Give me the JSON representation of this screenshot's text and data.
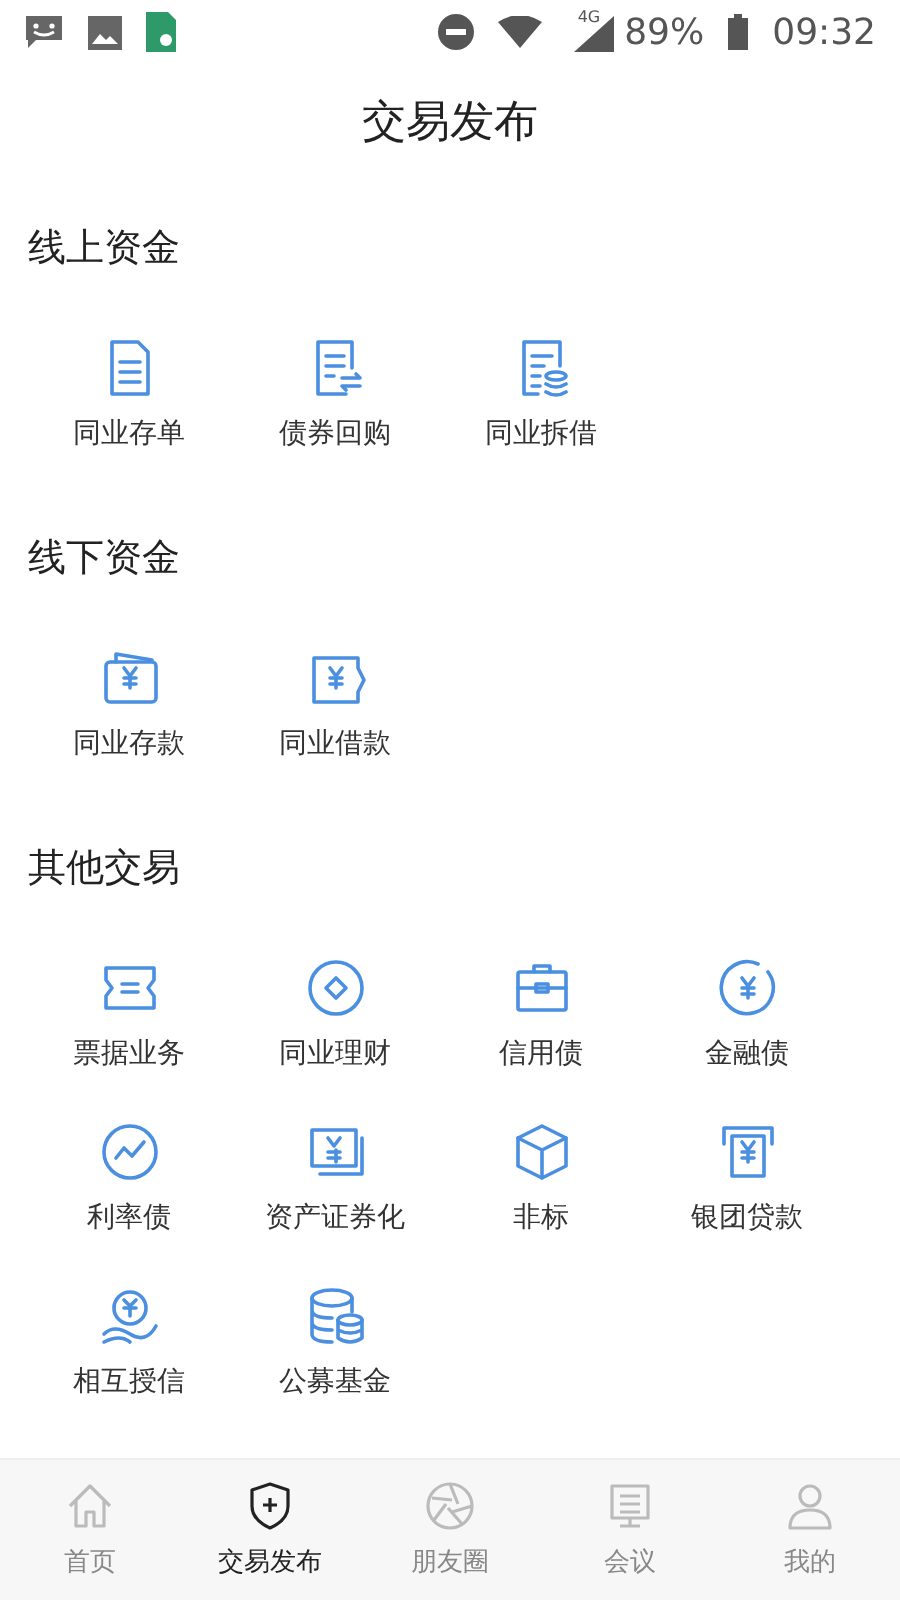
{
  "status_bar": {
    "network_type": "4G",
    "battery": "89%",
    "time": "09:32"
  },
  "header": {
    "title": "交易发布"
  },
  "sections": [
    {
      "title": "线上资金",
      "items": [
        {
          "label": "同业存单",
          "kind": "doc"
        },
        {
          "label": "债券回购",
          "kind": "swap"
        },
        {
          "label": "同业拆借",
          "kind": "coins"
        }
      ]
    },
    {
      "title": "线下资金",
      "items": [
        {
          "label": "同业存款",
          "kind": "wallet"
        },
        {
          "label": "同业借款",
          "kind": "voucher"
        }
      ]
    },
    {
      "title": "其他交易",
      "items": [
        {
          "label": "票据业务",
          "kind": "ticket"
        },
        {
          "label": "同业理财",
          "kind": "coin"
        },
        {
          "label": "信用债",
          "kind": "case"
        },
        {
          "label": "金融债",
          "kind": "yen"
        },
        {
          "label": "利率债",
          "kind": "trend"
        },
        {
          "label": "资产证券化",
          "kind": "bills"
        },
        {
          "label": "非标",
          "kind": "cube"
        },
        {
          "label": "银团贷款",
          "kind": "atm"
        },
        {
          "label": "相互授信",
          "kind": "hand"
        },
        {
          "label": "公募基金",
          "kind": "db"
        }
      ]
    }
  ],
  "tabs": [
    {
      "label": "首页",
      "kind": "home",
      "selected": false
    },
    {
      "label": "交易发布",
      "kind": "shield",
      "selected": true
    },
    {
      "label": "朋友圈",
      "kind": "aperture",
      "selected": false
    },
    {
      "label": "会议",
      "kind": "screen",
      "selected": false
    },
    {
      "label": "我的",
      "kind": "user",
      "selected": false
    }
  ]
}
